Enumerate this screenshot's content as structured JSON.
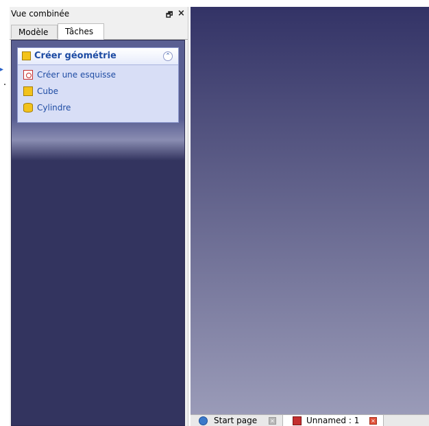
{
  "combo_view": {
    "title": "Vue combinée",
    "float_icon": "float-window-icon",
    "close_icon": "close-icon",
    "close_glyph": "×",
    "float_glyph": "🗗",
    "tabs": [
      {
        "label": "Modèle"
      },
      {
        "label": "Tâches",
        "active": true
      }
    ]
  },
  "task_panel": {
    "header": {
      "title": "Créer géométrie",
      "icon": "part-cube-icon",
      "collapse_icon": "collapse-up-icon",
      "collapse_glyph": "⌃"
    },
    "items": [
      {
        "label": "Créer une esquisse",
        "icon": "sketch-icon"
      },
      {
        "label": "Cube",
        "icon": "cube-icon"
      },
      {
        "label": "Cylindre",
        "icon": "cylinder-icon"
      }
    ]
  },
  "document_tabs": [
    {
      "label": "Start page",
      "icon": "globe-icon",
      "close_icon": "close-tab-icon",
      "close_glyph": "×"
    },
    {
      "label": "Unnamed : 1",
      "icon": "freecad-document-icon",
      "active": true,
      "close_icon": "close-tab-icon",
      "close_glyph": "×"
    }
  ],
  "view_3d": {
    "gradient_top": "#333366",
    "gradient_bottom": "#9a9bb8"
  },
  "margin": {
    "arrow_glyph": "▸"
  },
  "colors": {
    "accent_text": "#1d4ba3",
    "task_box_bg": "#d8def6",
    "task_pane_bg": "#33345f"
  }
}
